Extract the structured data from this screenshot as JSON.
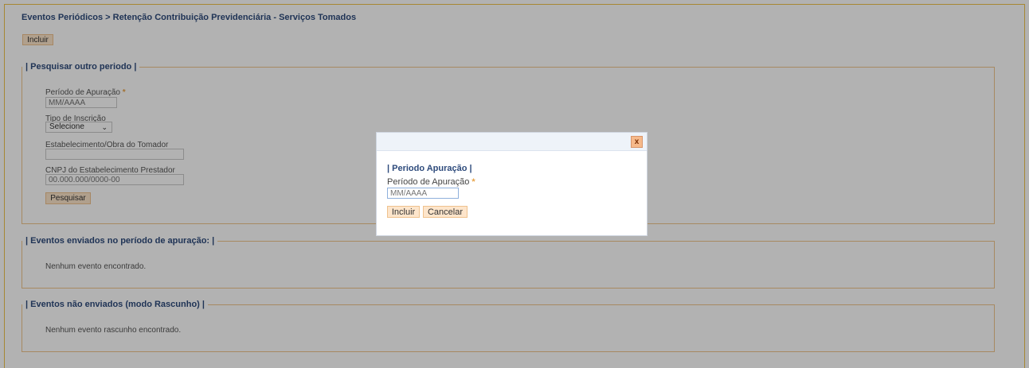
{
  "breadcrumb": "Eventos Periódicos > Retenção Contribuição Previdenciária - Serviços Tomados",
  "toolbar": {
    "incluir_label": "Incluir"
  },
  "search": {
    "legend": "| Pesquisar outro periodo |",
    "periodo_label": "Período de Apuração",
    "required_mark": "*",
    "periodo_placeholder": "MM/AAAA",
    "tipo_label": "Tipo de Inscrição",
    "tipo_selected": "Selecione",
    "estabelecimento_label": "Estabelecimento/Obra do Tomador",
    "cnpj_label": "CNPJ do Estabelecimento Prestador",
    "cnpj_placeholder": "00.000.000/0000-00",
    "search_button": "Pesquisar"
  },
  "sent": {
    "legend": "| Eventos enviados no período de apuração: |",
    "empty": "Nenhum evento encontrado."
  },
  "draft": {
    "legend": "| Eventos não enviados (modo Rascunho) |",
    "empty": "Nenhum evento rascunho encontrado."
  },
  "modal": {
    "close_label": "x",
    "title": "| Periodo Apuração |",
    "periodo_label": "Período de Apuração",
    "required_mark": "*",
    "periodo_placeholder": "MM/AAAA",
    "incluir_label": "Incluir",
    "cancelar_label": "Cancelar"
  },
  "icons": {
    "select_arrow": "chevron-down-icon",
    "close": "close-icon"
  },
  "colors": {
    "accent_border": "#f0c24a",
    "fieldset_border": "#f0c48c",
    "button_bg": "#fde5cb",
    "heading_text": "#2e4b7c",
    "required": "#e8a44a"
  }
}
